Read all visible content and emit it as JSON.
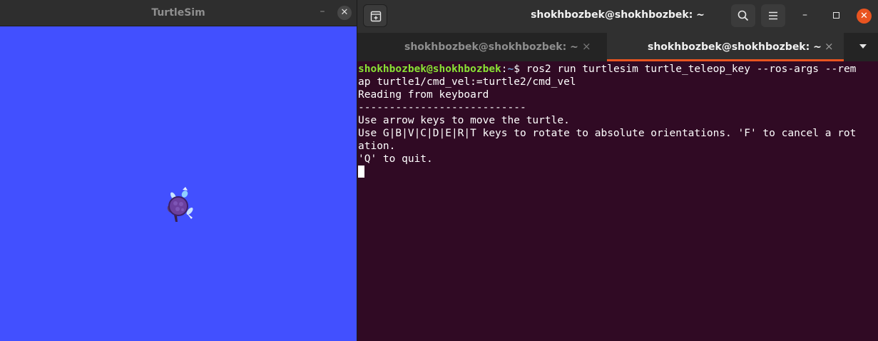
{
  "turtlesim": {
    "title": "TurtleSim",
    "minimize_glyph": "–",
    "close_glyph": "✕",
    "background_color": "#4250ff"
  },
  "terminal": {
    "title": "shokhbozbek@shokhbozbek: ~",
    "close_glyph": "✕",
    "minimize_glyph": "–",
    "accent_color": "#e95420",
    "background_color": "#300a24",
    "tabs": [
      {
        "label": "shokhbozbek@shokhbozbek: ~",
        "close": "×",
        "active": false
      },
      {
        "label": "shokhbozbek@shokhbozbek: ~",
        "close": "×",
        "active": true
      }
    ],
    "prompt": {
      "user_host": "shokhbozbek@shokhbozbek",
      "colon": ":",
      "path": "~",
      "symbol": "$ "
    },
    "command_line1": "ros2 run turtlesim turtle_teleop_key --ros-args --rem",
    "command_line2": "ap turtle1/cmd_vel:=turtle2/cmd_vel",
    "output": [
      "Reading from keyboard",
      "---------------------------",
      "Use arrow keys to move the turtle.",
      "Use G|B|V|C|D|E|R|T keys to rotate to absolute orientations. 'F' to cancel a rot",
      "ation.",
      "'Q' to quit."
    ]
  },
  "icons": {
    "new_tab": "new-tab-icon",
    "search": "search-icon",
    "menu": "hamburger-menu-icon",
    "turtle": "turtle-icon"
  }
}
